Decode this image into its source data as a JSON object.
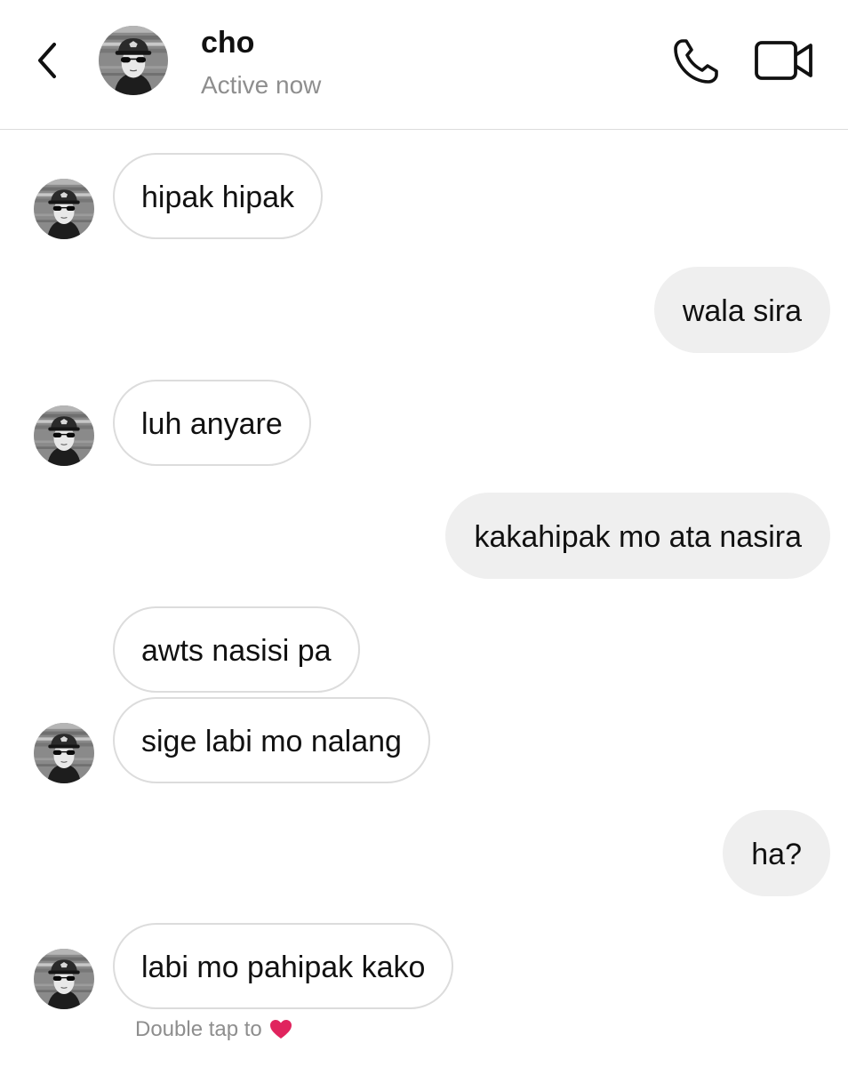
{
  "header": {
    "contact_name": "cho",
    "status": "Active now"
  },
  "messages": [
    {
      "direction": "in",
      "text": "hipak hipak"
    },
    {
      "direction": "out",
      "text": "wala sira"
    },
    {
      "direction": "in",
      "text": "luh anyare"
    },
    {
      "direction": "out",
      "text": "kakahipak mo ata nasira"
    },
    {
      "direction": "in",
      "text": "awts nasisi pa"
    },
    {
      "direction": "in",
      "text": "sige labi mo nalang"
    },
    {
      "direction": "out",
      "text": "ha?"
    },
    {
      "direction": "in",
      "text": "labi mo pahipak kako"
    }
  ],
  "hint": {
    "text": "Double tap to",
    "emoji_icon": "red-heart-icon"
  },
  "icons": {
    "back": "chevron-left-icon",
    "call": "phone-icon",
    "video": "video-camera-icon"
  },
  "colors": {
    "incoming_border": "#dcdcdc",
    "outgoing_bg": "#efefef",
    "secondary_text": "#8e8e8e",
    "heart": "#e0245e"
  }
}
